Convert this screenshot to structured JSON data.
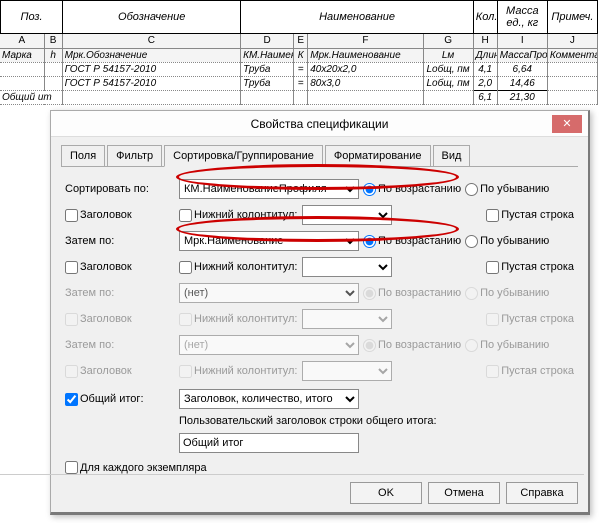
{
  "schedule": {
    "head": {
      "pos": "Поз.",
      "desig": "Обозначение",
      "name": "Наименование",
      "qty": "Кол.",
      "mass": "Масса ед., кг",
      "note": "Примеч."
    },
    "letters": {
      "A": "A",
      "B": "B",
      "C": "C",
      "D": "D",
      "E": "E",
      "F": "F",
      "G": "G",
      "H": "H",
      "I": "I",
      "J": "J"
    },
    "subhead": {
      "marka": "Марка",
      "h": "h",
      "mrkdesig": "Мрк.Обозначение",
      "kmname": "КМ.Наименов",
      "K": "К",
      "mrkname": "Мрк.Наименование",
      "lm": "Lм",
      "len": "ДлинаО",
      "massp": "МассаПрокс",
      "komm": "Комментарии"
    },
    "rows": [
      {
        "desig": "ГОСТ Р 54157-2010",
        "km": "Труба",
        "eq": "=",
        "mrkname": "40x20x2,0",
        "lm": "Lобщ, пм",
        "len": "4,1",
        "mass": "6,64"
      },
      {
        "desig": "ГОСТ Р 54157-2010",
        "km": "Труба",
        "eq": "=",
        "mrkname": "80x3,0",
        "lm": "Lобщ, пм",
        "len": "2,0",
        "mass": "14,46"
      }
    ],
    "total_label": "Общий ит",
    "total_len": "6,1",
    "total_mass": "21,30"
  },
  "dialog": {
    "title": "Свойства спецификации",
    "close": "✕",
    "tabs": {
      "fields": "Поля",
      "filter": "Фильтр",
      "sort": "Сортировка/Группирование",
      "format": "Форматирование",
      "view": "Вид"
    },
    "labels": {
      "sort_by": "Сортировать по:",
      "then_by": "Затем по:",
      "header": "Заголовок",
      "footer": "Нижний колонтитул:",
      "blank": "Пустая строка",
      "asc": "По возрастанию",
      "desc": "По убыванию",
      "grand": "Общий итог:",
      "gt_custom": "Пользовательский заголовок строки общего итога:",
      "each_inst": "Для каждого экземпляра"
    },
    "selects": {
      "sort1": "КМ.НаименованиеПрофиля",
      "footer1": "",
      "sort2": "Мрк.Наименование",
      "footer2": "",
      "sort3": "(нет)",
      "footer3": "",
      "sort4": "(нет)",
      "footer4": "",
      "gt_mode": "Заголовок, количество, итого"
    },
    "gt_text": "Общий итог",
    "buttons": {
      "ok": "OK",
      "cancel": "Отмена",
      "help": "Справка"
    }
  }
}
